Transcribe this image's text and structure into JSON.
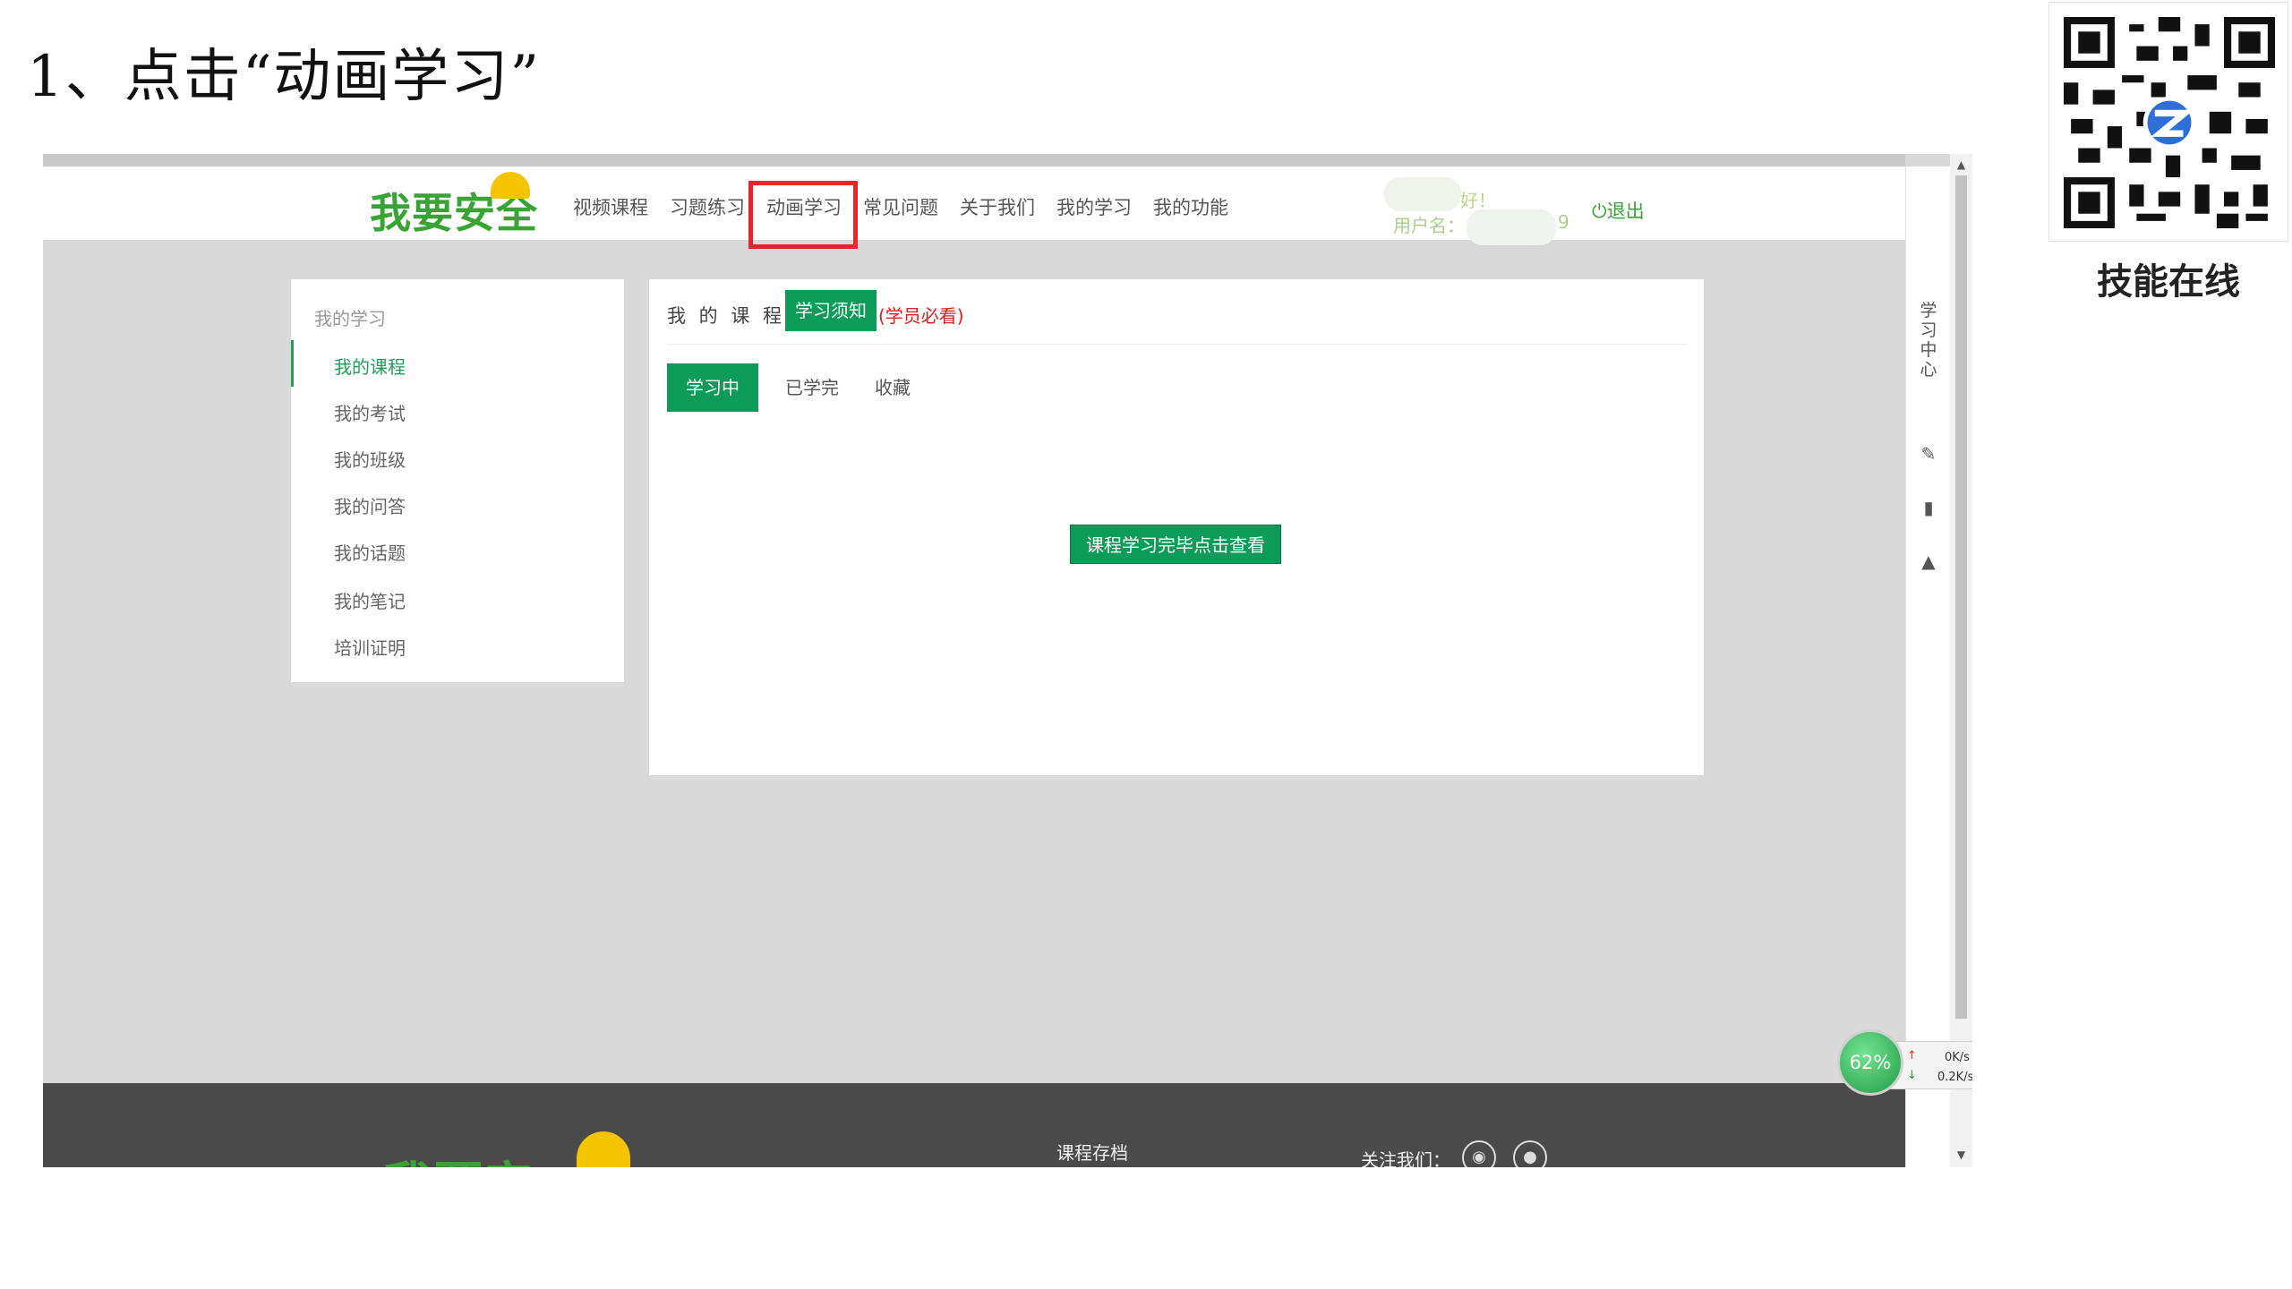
{
  "slide": {
    "title": "1、点击“动画学习”"
  },
  "qr": {
    "caption": "技能在线"
  },
  "site": {
    "logo": "我要安全",
    "nav": [
      "视频课程",
      "习题练习",
      "动画学习",
      "常见问题",
      "关于我们",
      "我的学习",
      "我的功能"
    ],
    "greeting": "好！",
    "username_label": "用户名：",
    "username_tail": "9",
    "logout": "退出"
  },
  "sidebar": {
    "title": "我的学习",
    "items": [
      "我的课程",
      "我的考试",
      "我的班级",
      "我的问答",
      "我的话题",
      "我的笔记",
      "培训证明"
    ]
  },
  "main": {
    "heading": "我 的 课 程",
    "notice": "学习须知",
    "notice_note": "(学员必看)",
    "tabs": [
      "学习中",
      "已学完",
      "收藏"
    ],
    "view_button": "课程学习完毕点击查看"
  },
  "rightbar": {
    "label": "学习中心"
  },
  "footer": {
    "logo": "我要安",
    "archive": "课程存档",
    "follow": "关注我们："
  },
  "speed_widget": {
    "percent": "62%",
    "up": "0K/s",
    "down": "0.2K/s"
  },
  "colors": {
    "accent": "#0d9b5a",
    "highlight": "#e8242c",
    "logo": "#3aa336"
  }
}
